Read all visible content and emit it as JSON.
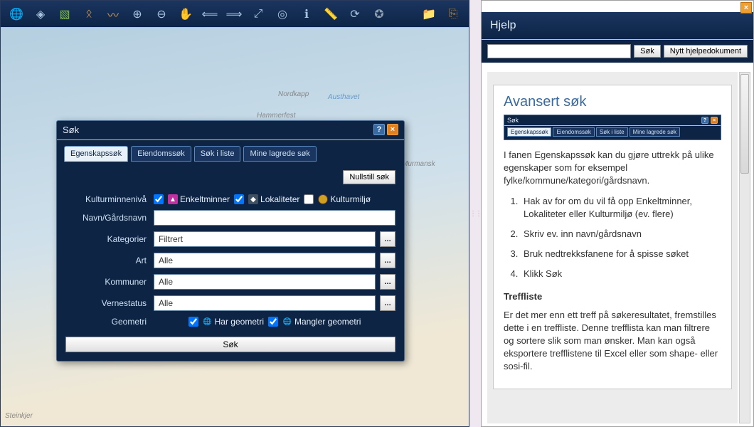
{
  "toolbar_icons": [
    "globe-icon",
    "layers-icon",
    "image-layer-icon",
    "region-icon",
    "draw-icon",
    "zoom-in-icon",
    "zoom-out-icon",
    "pan-icon",
    "back-icon",
    "forward-icon",
    "zoom-extent-icon",
    "goto-icon",
    "info-icon",
    "measure-icon",
    "refresh-icon",
    "gps-icon",
    "spacer",
    "folder-add-icon",
    "exit-icon"
  ],
  "map_labels": {
    "nordkapp": "Nordkapp",
    "hammerfest": "Hammerfest",
    "austhavet": "Austhavet",
    "murmansk": "Murmansk",
    "steinkjer": "Steinkjer"
  },
  "search": {
    "title": "Søk",
    "tabs": [
      "Egenskapssøk",
      "Eiendomssøk",
      "Søk i liste",
      "Mine lagrede søk"
    ],
    "reset": "Nullstill søk",
    "levels_label": "Kulturminnenivå",
    "levels": {
      "enk": "Enkeltminner",
      "lok": "Lokaliteter",
      "kul": "Kulturmiljø"
    },
    "fields": {
      "navn": "Navn/Gårdsnavn",
      "kategorier": "Kategorier",
      "art": "Art",
      "kommuner": "Kommuner",
      "vernestatus": "Vernestatus",
      "geometri": "Geometri"
    },
    "values": {
      "kategorier": "Filtrert",
      "art": "Alle",
      "kommuner": "Alle",
      "vernestatus": "Alle"
    },
    "geom": {
      "har": "Har geometri",
      "mangler": "Mangler geometri"
    },
    "search_btn": "Søk"
  },
  "help": {
    "title": "Hjelp",
    "search_btn": "Søk",
    "new_doc_btn": "Nytt hjelpedokument",
    "doc": {
      "heading": "Avansert søk",
      "intro": "I fanen Egenskapssøk kan du gjøre uttrekk på ulike egenskaper som for eksempel fylke/kommune/kategori/gårdsnavn.",
      "steps": [
        "Hak av for om du vil få opp Enkeltminner, Lokaliteter eller Kulturmiljø (ev. flere)",
        "Skriv ev. inn navn/gårdsnavn",
        "Bruk nedtrekksfanene for å spisse søket",
        "Klikk Søk"
      ],
      "treffliste_h": "Treffliste",
      "treffliste_p": "Er det mer enn ett treff på søkeresultatet, fremstilles dette i en treffliste. Denne trefflista kan man filtrere og sortere slik som man ønsker. Man kan også eksportere trefflistene til Excel eller som shape- eller sosi-fil."
    }
  }
}
